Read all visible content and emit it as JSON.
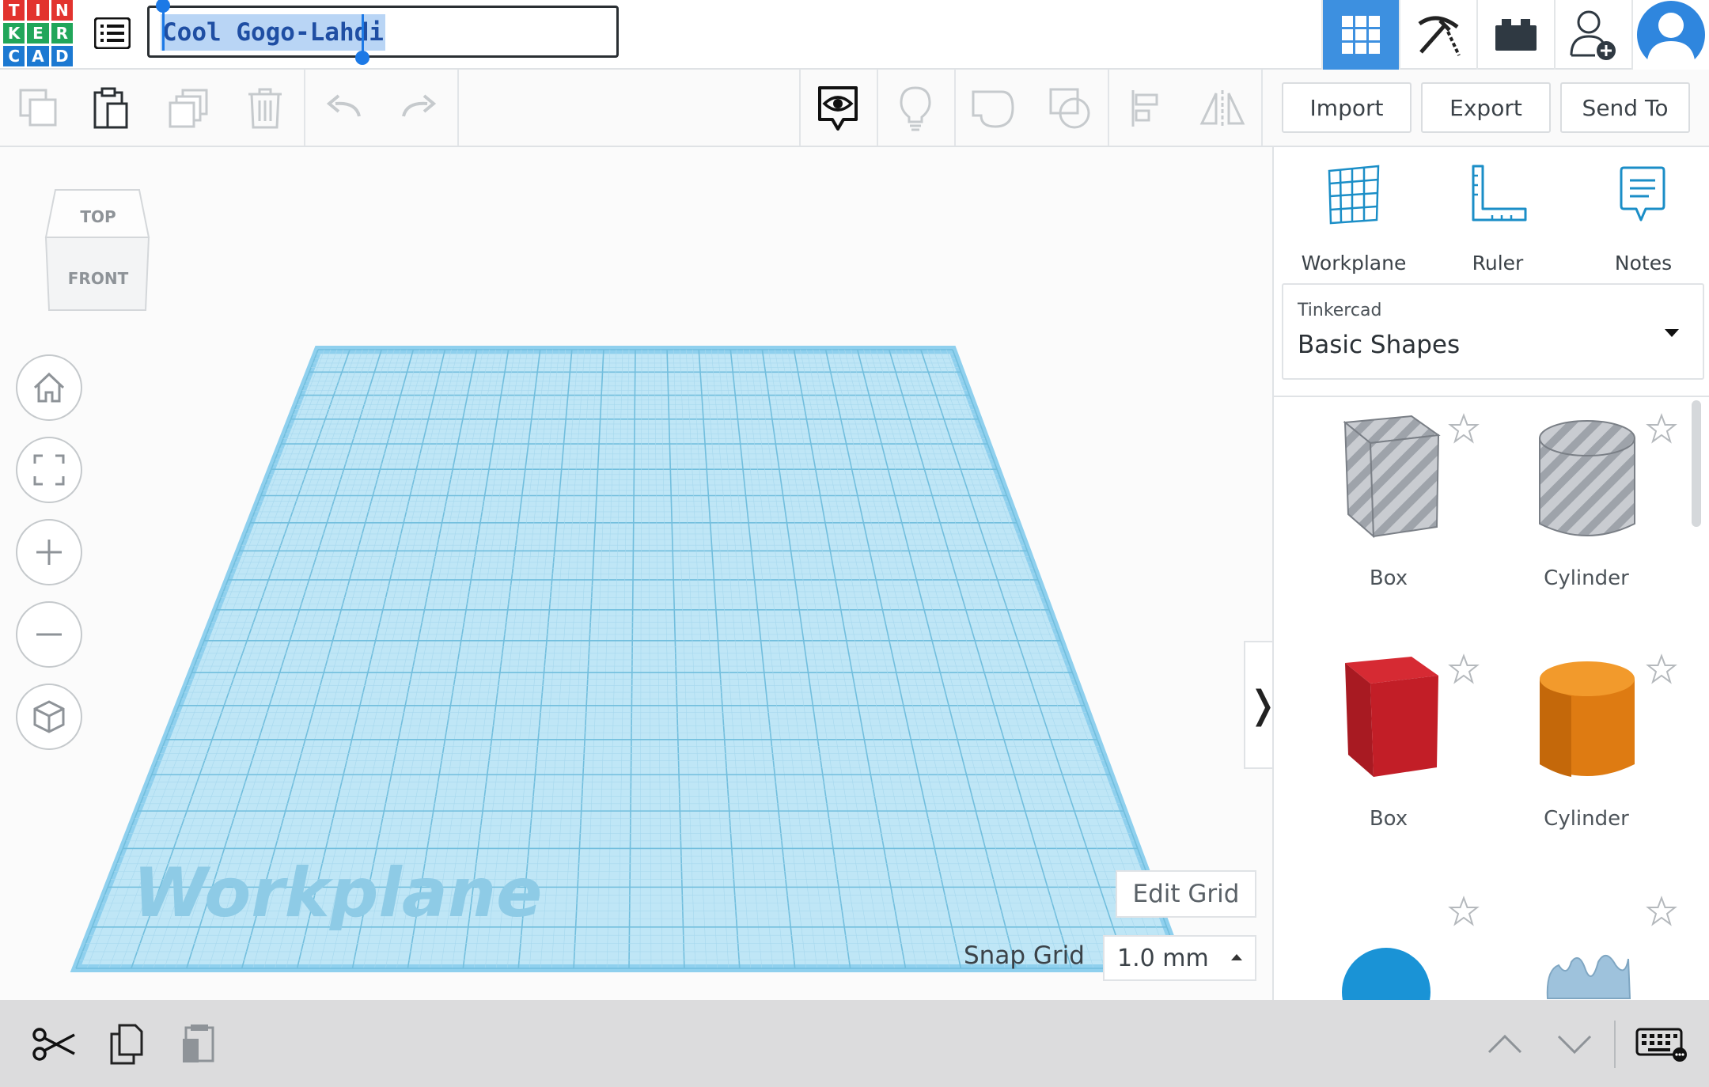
{
  "app": {
    "logo_letters": [
      "T",
      "I",
      "N",
      "K",
      "E",
      "R",
      "C",
      "A",
      "D"
    ],
    "logo_colors": [
      "#e2332e",
      "#e2332e",
      "#e2332e",
      "#21a65a",
      "#21a65a",
      "#21a65a",
      "#1c79d2",
      "#1c79d2",
      "#1c79d2"
    ],
    "design_title": "Cool Gogo-Lahdi",
    "accent": "#3d90e0"
  },
  "topbar": {
    "icons": [
      "list-icon",
      "grid-icon",
      "pickaxe-icon",
      "brick-icon",
      "add-user-icon",
      "avatar"
    ]
  },
  "toolbar": {
    "import_label": "Import",
    "export_label": "Export",
    "send_to_label": "Send To"
  },
  "viewport": {
    "viewcube_top": "TOP",
    "viewcube_front": "FRONT",
    "workplane_label": "Workplane",
    "edit_grid_label": "Edit Grid",
    "snap_grid_label": "Snap Grid",
    "snap_grid_value": "1.0 mm",
    "collapse_glyph": "❭"
  },
  "panel": {
    "tools": [
      {
        "label": "Workplane"
      },
      {
        "label": "Ruler"
      },
      {
        "label": "Notes"
      }
    ],
    "library_category": "Tinkercad",
    "library_name": "Basic Shapes",
    "shapes": [
      {
        "label": "Box"
      },
      {
        "label": "Cylinder"
      },
      {
        "label": "Box"
      },
      {
        "label": "Cylinder"
      }
    ]
  }
}
